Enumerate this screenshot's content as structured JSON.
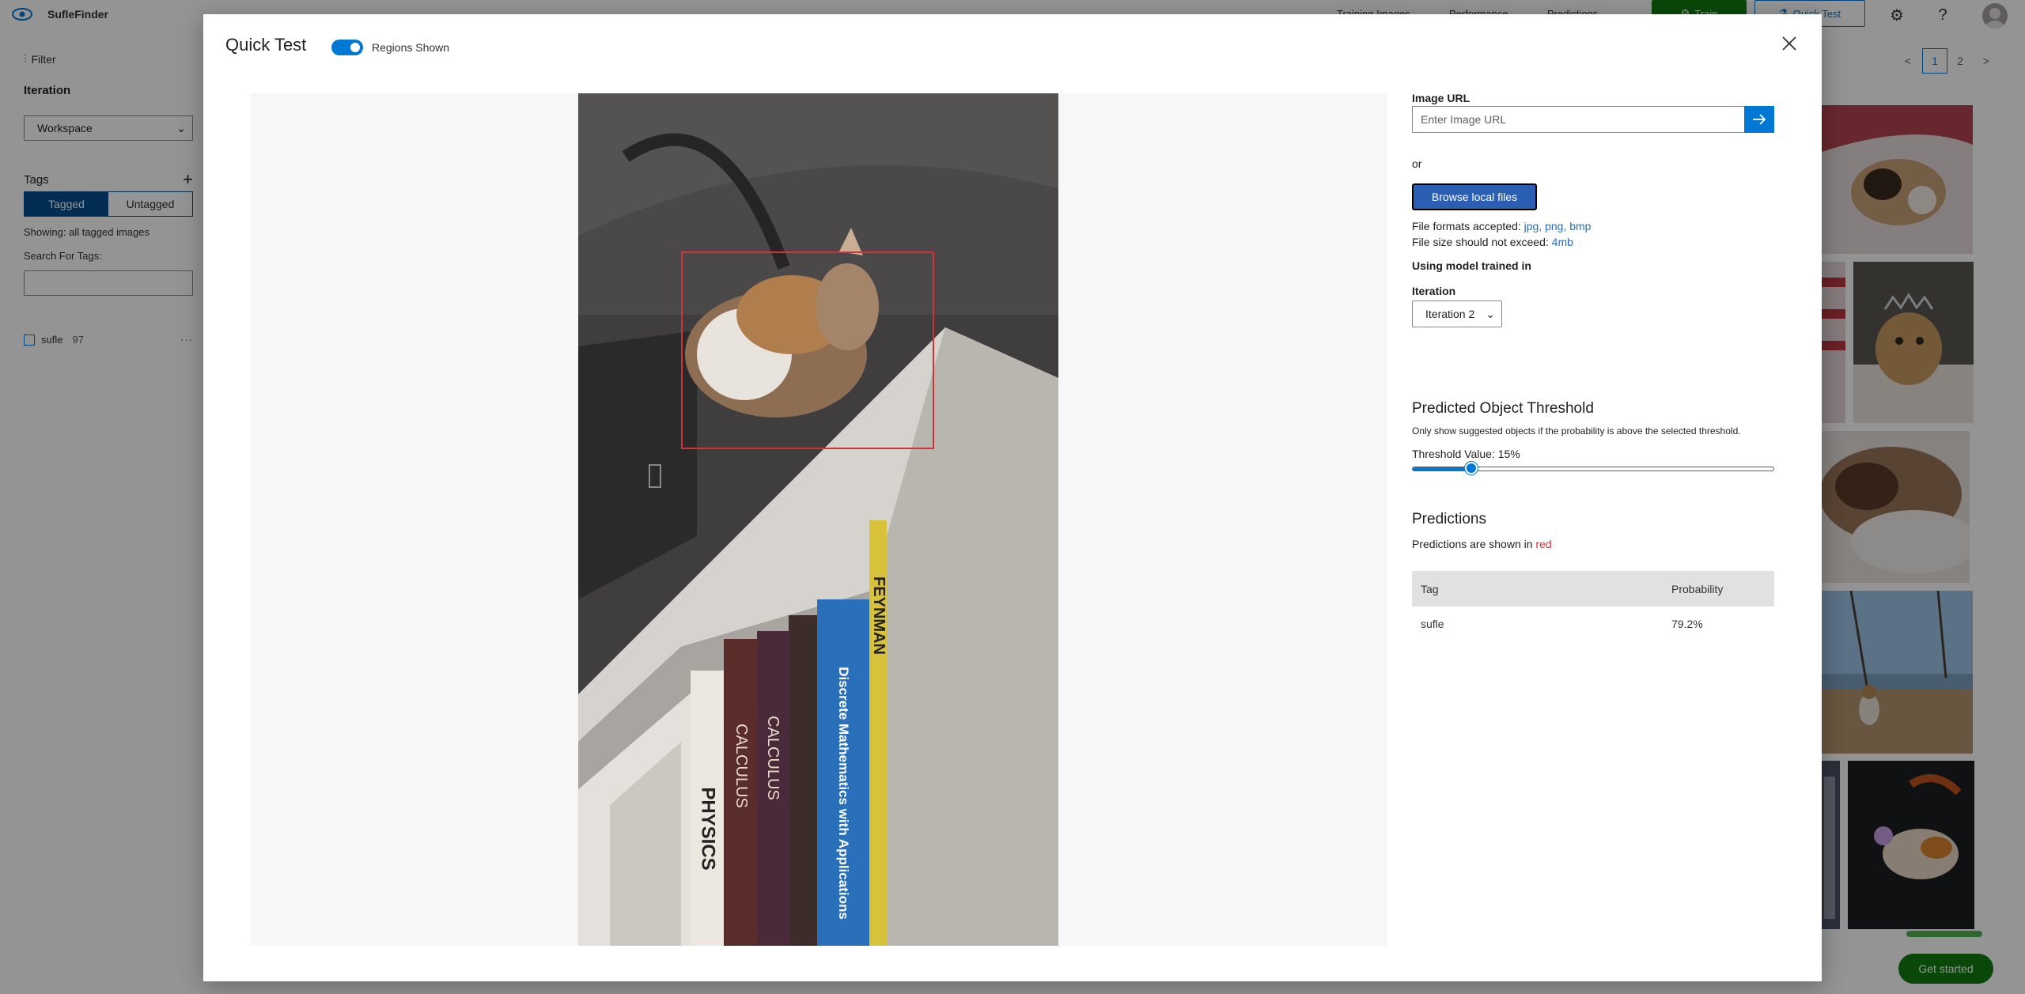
{
  "app": {
    "name": "SufleFinder",
    "nav": [
      "Training Images",
      "Performance",
      "Predictions"
    ],
    "train_label": "Train",
    "quick_test_label": "Quick Test"
  },
  "sidebar": {
    "filter_label": "Filter",
    "iteration_heading": "Iteration",
    "iteration_value": "Workspace",
    "tags_heading": "Tags",
    "segments": [
      "Tagged",
      "Untagged"
    ],
    "showing_text": "Showing: all tagged images",
    "search_label": "Search For Tags:",
    "tags": [
      {
        "name": "sufle",
        "count": "97"
      }
    ]
  },
  "pagination": {
    "prev": "<",
    "pages": [
      "1",
      "2"
    ],
    "next": ">"
  },
  "get_started_label": "Get started",
  "modal": {
    "title": "Quick Test",
    "regions_toggle_label": "Regions Shown",
    "regions_shown": true,
    "image_url_label": "Image URL",
    "image_url_placeholder": "Enter Image URL",
    "or_text": "or",
    "browse_label": "Browse local files",
    "formats_prefix": "File formats accepted: ",
    "formats": "jpg, png, bmp",
    "size_prefix": "File size should not exceed: ",
    "size_limit": "4mb",
    "model_label": "Using model trained in",
    "iteration_label": "Iteration",
    "iteration_value": "Iteration 2",
    "threshold_heading": "Predicted Object Threshold",
    "threshold_help": "Only show suggested objects if the probability is above the selected threshold.",
    "threshold_prefix": "Threshold Value: ",
    "threshold_value": "15%",
    "threshold_fraction": 0.15,
    "predictions_heading": "Predictions",
    "predictions_note_prefix": "Predictions are shown in ",
    "predictions_note_color": "red",
    "table_headers": {
      "tag": "Tag",
      "probability": "Probability"
    },
    "predictions": [
      {
        "tag": "sufle",
        "probability": "79.2%"
      }
    ],
    "book_titles": [
      "PHYSICS",
      "CALCULUS",
      "CALCULUS",
      "Discrete Mathematics with Applications",
      "FEYNMAN"
    ]
  },
  "colors": {
    "accent": "#0078d4",
    "train_green": "#107c10",
    "prediction_red": "#d13438",
    "browse_blue": "#2b5fb4"
  }
}
